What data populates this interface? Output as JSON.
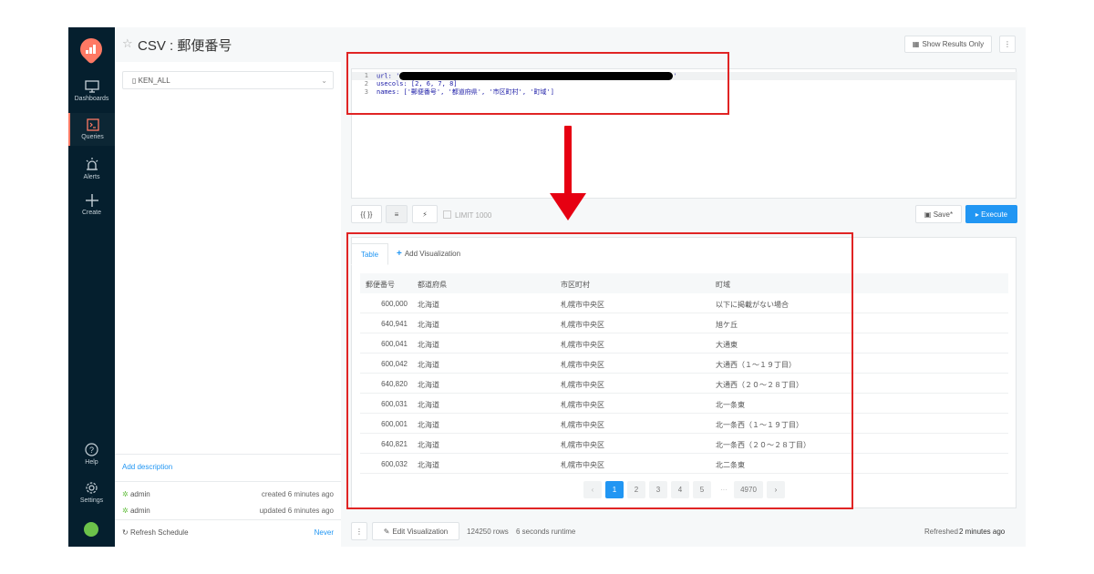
{
  "nav": {
    "items": [
      {
        "label": "Dashboards",
        "icon": "monitor-icon"
      },
      {
        "label": "Queries",
        "icon": "terminal-icon"
      },
      {
        "label": "Alerts",
        "icon": "alarm-icon"
      },
      {
        "label": "Create",
        "icon": "plus-icon"
      }
    ],
    "help_label": "Help",
    "settings_label": "Settings"
  },
  "header": {
    "title": "CSV : 郵便番号",
    "show_results_label": "Show Results Only",
    "more_label": "⋮"
  },
  "left_panel": {
    "schema_value": "KEN_ALL",
    "add_description": "Add description",
    "created_by": "admin",
    "created_text": "created 6 minutes ago",
    "updated_by": "admin",
    "updated_text": "updated 6 minutes ago",
    "refresh_label": "Refresh Schedule",
    "refresh_value": "Never"
  },
  "editor": {
    "lines": [
      {
        "num": "1",
        "pre": "url: '",
        "post": "'"
      },
      {
        "num": "2",
        "text": "usecols: [2, 6, 7, 8]"
      },
      {
        "num": "3",
        "text": "names: ['郵便番号', '都道府県', '市区町村', '町域']"
      }
    ]
  },
  "toolbar": {
    "params_label": "{{ }}",
    "format_label": "≡",
    "autocomplete_label": "⚡",
    "limit_label": "LIMIT 1000",
    "save_label": "Save*",
    "execute_label": "▸ Execute"
  },
  "results": {
    "tab_table": "Table",
    "tab_add": "Add Visualization",
    "columns": [
      "郵便番号",
      "都道府県",
      "市区町村",
      "町域"
    ],
    "rows": [
      [
        "600,000",
        "北海道",
        "札幌市中央区",
        "以下に掲載がない場合"
      ],
      [
        "640,941",
        "北海道",
        "札幌市中央区",
        "旭ケ丘"
      ],
      [
        "600,041",
        "北海道",
        "札幌市中央区",
        "大通東"
      ],
      [
        "600,042",
        "北海道",
        "札幌市中央区",
        "大通西（１〜１９丁目）"
      ],
      [
        "640,820",
        "北海道",
        "札幌市中央区",
        "大通西（２０〜２８丁目）"
      ],
      [
        "600,031",
        "北海道",
        "札幌市中央区",
        "北一条東"
      ],
      [
        "600,001",
        "北海道",
        "札幌市中央区",
        "北一条西（１〜１９丁目）"
      ],
      [
        "640,821",
        "北海道",
        "札幌市中央区",
        "北一条西（２０〜２８丁目）"
      ],
      [
        "600,032",
        "北海道",
        "札幌市中央区",
        "北二条東"
      ]
    ],
    "pagination": {
      "prev": "‹",
      "pages": [
        "1",
        "2",
        "3",
        "4",
        "5"
      ],
      "ellipsis": "···",
      "last": "4970",
      "next": "›"
    }
  },
  "footer": {
    "more_label": "⋮",
    "edit_vis_label": "Edit Visualization",
    "rows_text": "124250 rows",
    "runtime_text": "6 seconds runtime",
    "refreshed_text": "Refreshed",
    "refreshed_time": "2 minutes ago"
  },
  "colors": {
    "accent": "#2196f3",
    "nav_bg": "#051f2e",
    "annotation_red": "#e02424"
  }
}
